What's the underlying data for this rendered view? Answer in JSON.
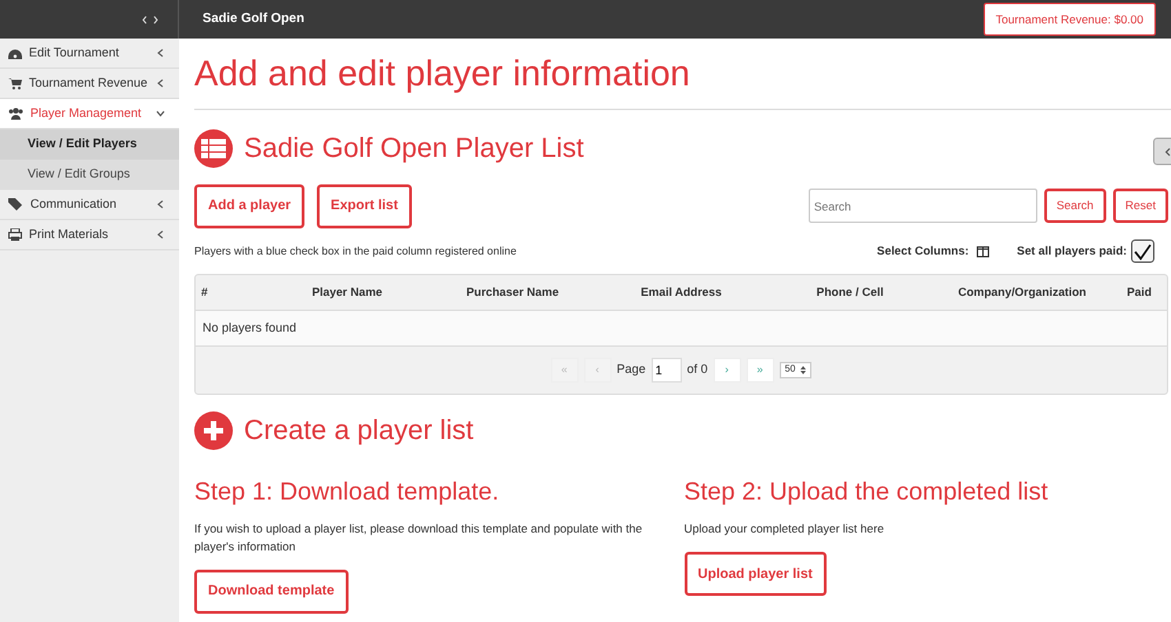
{
  "topbar": {
    "title": "Sadie Golf Open",
    "revenue_button": "Tournament Revenue: $0.00"
  },
  "sidebar": {
    "items": [
      {
        "label": "Edit Tournament",
        "expanded": false
      },
      {
        "label": "Tournament Revenue",
        "expanded": false
      },
      {
        "label": "Player Management",
        "expanded": true,
        "children": [
          {
            "label": "View / Edit Players",
            "selected": true
          },
          {
            "label": "View / Edit Groups",
            "selected": false
          }
        ]
      },
      {
        "label": "Communication",
        "expanded": false
      },
      {
        "label": "Print Materials",
        "expanded": false
      }
    ]
  },
  "page_title": "Add and edit player information",
  "list_section": {
    "title": "Sadie Golf Open Player List",
    "buttons": [
      "Add a player",
      "Export list"
    ],
    "search": {
      "placeholder": "Search",
      "button": "Search",
      "reset": "Reset"
    },
    "note": "Players with a blue check box in the paid column registered online",
    "select_columns": "Select Columns:",
    "set_all_paid": {
      "label": "Set all players paid:",
      "checked": true
    },
    "table": {
      "columns": [
        "#",
        "Player Name",
        "Purchaser Name",
        "Email Address",
        "Phone / Cell",
        "Company/Organization",
        "Paid"
      ],
      "empty_message": "No players found"
    },
    "pager": {
      "first": "«",
      "prev": "‹",
      "page_label": "Page",
      "page": "1",
      "of": "of 0",
      "next": "›",
      "last": "»",
      "page_size": "50"
    }
  },
  "create_section": {
    "title": "Create a player list",
    "steps": [
      {
        "title": "Step 1: Download template.",
        "text": "If you wish to upload a player list, please download this template and populate with the player's information",
        "button": "Download template"
      },
      {
        "title": "Step 2: Upload the completed list",
        "text": "Upload your completed player list here",
        "button": "Upload player list"
      }
    ]
  }
}
